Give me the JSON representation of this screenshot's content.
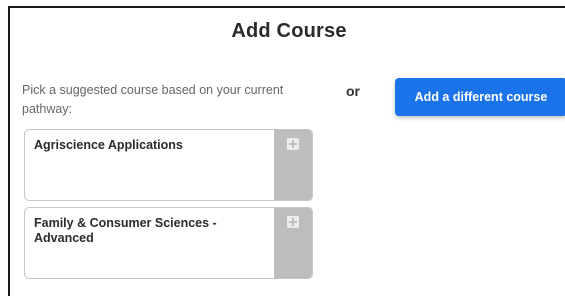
{
  "dialog": {
    "title": "Add Course",
    "prompt": "Pick a suggested course based on your current pathway:",
    "or_label": "or",
    "add_different_label": "Add a different course"
  },
  "suggested_courses": [
    {
      "name": "Agriscience Applications"
    },
    {
      "name": "Family & Consumer Sciences - Advanced"
    }
  ],
  "colors": {
    "accent": "#1a73e8",
    "add_strip": "#bdbdbd"
  }
}
